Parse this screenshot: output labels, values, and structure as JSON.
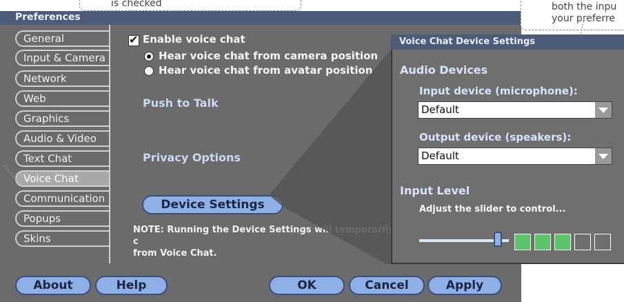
{
  "window": {
    "title": "Preferences"
  },
  "tabs": [
    {
      "label": "General"
    },
    {
      "label": "Input & Camera"
    },
    {
      "label": "Network"
    },
    {
      "label": "Web"
    },
    {
      "label": "Graphics"
    },
    {
      "label": "Audio & Video"
    },
    {
      "label": "Text Chat"
    },
    {
      "label": "Voice Chat"
    },
    {
      "label": "Communication"
    },
    {
      "label": "Popups"
    },
    {
      "label": "Skins"
    }
  ],
  "voice": {
    "enable_label": "Enable voice chat",
    "enable_checked": true,
    "radio_camera": "Hear voice chat from camera position",
    "radio_avatar": "Hear voice chat from avatar position",
    "push_to_talk": "Push to Talk",
    "privacy": "Privacy Options",
    "device_settings_button": "Device Settings",
    "note": "NOTE: Running the Device Settings will temporarily c",
    "note_line2": "from Voice Chat."
  },
  "footer": {
    "about": "About",
    "help": "Help",
    "ok": "OK",
    "cancel": "Cancel",
    "apply": "Apply"
  },
  "device_dialog": {
    "title": "Voice Chat Device Settings",
    "audio_devices": "Audio Devices",
    "input_label": "Input device (microphone):",
    "input_value": "Default",
    "output_label": "Output device (speakers):",
    "output_value": "Default",
    "input_level": "Input Level",
    "adjust_text": "Adjust the slider to control...",
    "level_boxes_lit": 3,
    "level_boxes_total": 5
  },
  "callouts": {
    "top_left": "is checked",
    "top_right_line1": "both the inpu",
    "top_right_line2": "your preferre"
  },
  "colors": {
    "title_bar": "#4d5b78",
    "window_bg": "#6b6b6b",
    "button_fill": "#8fb0e6",
    "level_lit": "#5cc46a"
  }
}
